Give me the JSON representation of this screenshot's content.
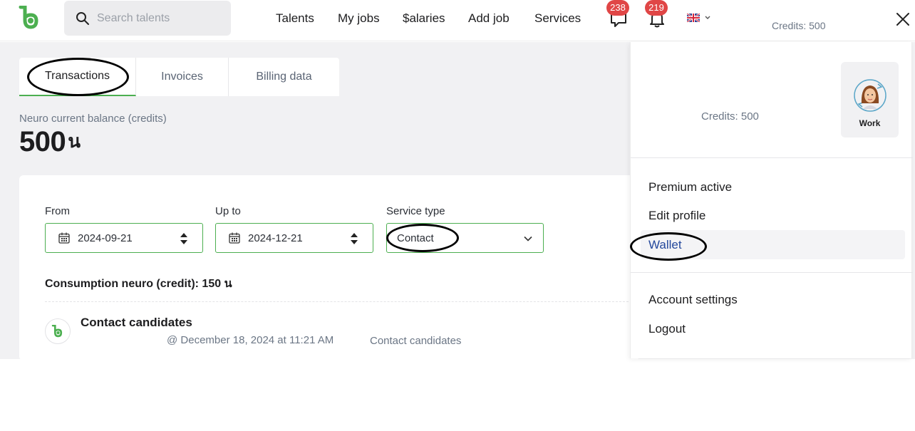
{
  "header": {
    "search_placeholder": "Search talents",
    "nav": [
      "Talents",
      "My jobs",
      "$alaries",
      "Add job",
      "Services"
    ],
    "messages_count": "238",
    "notifications_count": "219",
    "credits": "Credits: 500"
  },
  "tabs": [
    "Transactions",
    "Invoices",
    "Billing data"
  ],
  "balance": {
    "label": "Neuro current balance (credits)",
    "value": "500",
    "symbol": "น"
  },
  "filters": {
    "from_label": "From",
    "from_value": "2024-09-21",
    "upto_label": "Up to",
    "upto_value": "2024-12-21",
    "service_label": "Service type",
    "service_value": "Contact"
  },
  "consumption": "Consumption neuro (credit): 150 น",
  "transaction": {
    "title": "Contact candidates",
    "date": "@ December 18, 2024 at 11:21 AM",
    "service": "Contact candidates"
  },
  "account_menu": {
    "credits": "Credits: 500",
    "work_label": "Work",
    "items": [
      "Premium active",
      "Edit profile",
      "Wallet",
      "Account settings",
      "Logout"
    ]
  },
  "colors": {
    "accent_green": "#4caf50",
    "badge_red": "#e04646",
    "wallet_blue": "#24489c"
  }
}
